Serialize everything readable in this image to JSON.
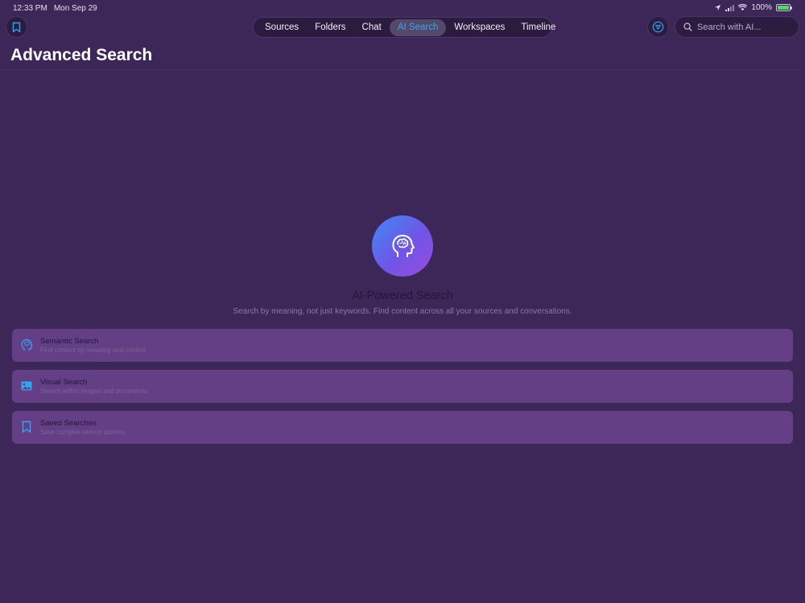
{
  "status": {
    "time": "12:33 PM",
    "date": "Mon Sep 29",
    "battery": "100%"
  },
  "nav": {
    "tabs": [
      {
        "label": "Sources"
      },
      {
        "label": "Folders"
      },
      {
        "label": "Chat"
      },
      {
        "label": "AI Search",
        "active": true
      },
      {
        "label": "Workspaces"
      },
      {
        "label": "Timeline"
      }
    ],
    "search_placeholder": "Search with AI..."
  },
  "page": {
    "title": "Advanced Search"
  },
  "hero": {
    "title": "AI-Powered Search",
    "subtitle": "Search by meaning, not just keywords. Find content across all your sources and conversations.",
    "icon": "brain-head-icon"
  },
  "cards": [
    {
      "title": "Semantic Search",
      "subtitle": "Find content by meaning and context",
      "icon": "brain-head-icon"
    },
    {
      "title": "Visual Search",
      "subtitle": "Search within images and documents",
      "icon": "photo-icon"
    },
    {
      "title": "Saved Searches",
      "subtitle": "Save complex search queries",
      "icon": "bookmark-icon"
    }
  ],
  "colors": {
    "background": "#3d2658",
    "accent": "#2ea8f0",
    "card": "#643f86",
    "hero_gradient_start": "#3e8af2",
    "hero_gradient_end": "#9a4be0"
  }
}
